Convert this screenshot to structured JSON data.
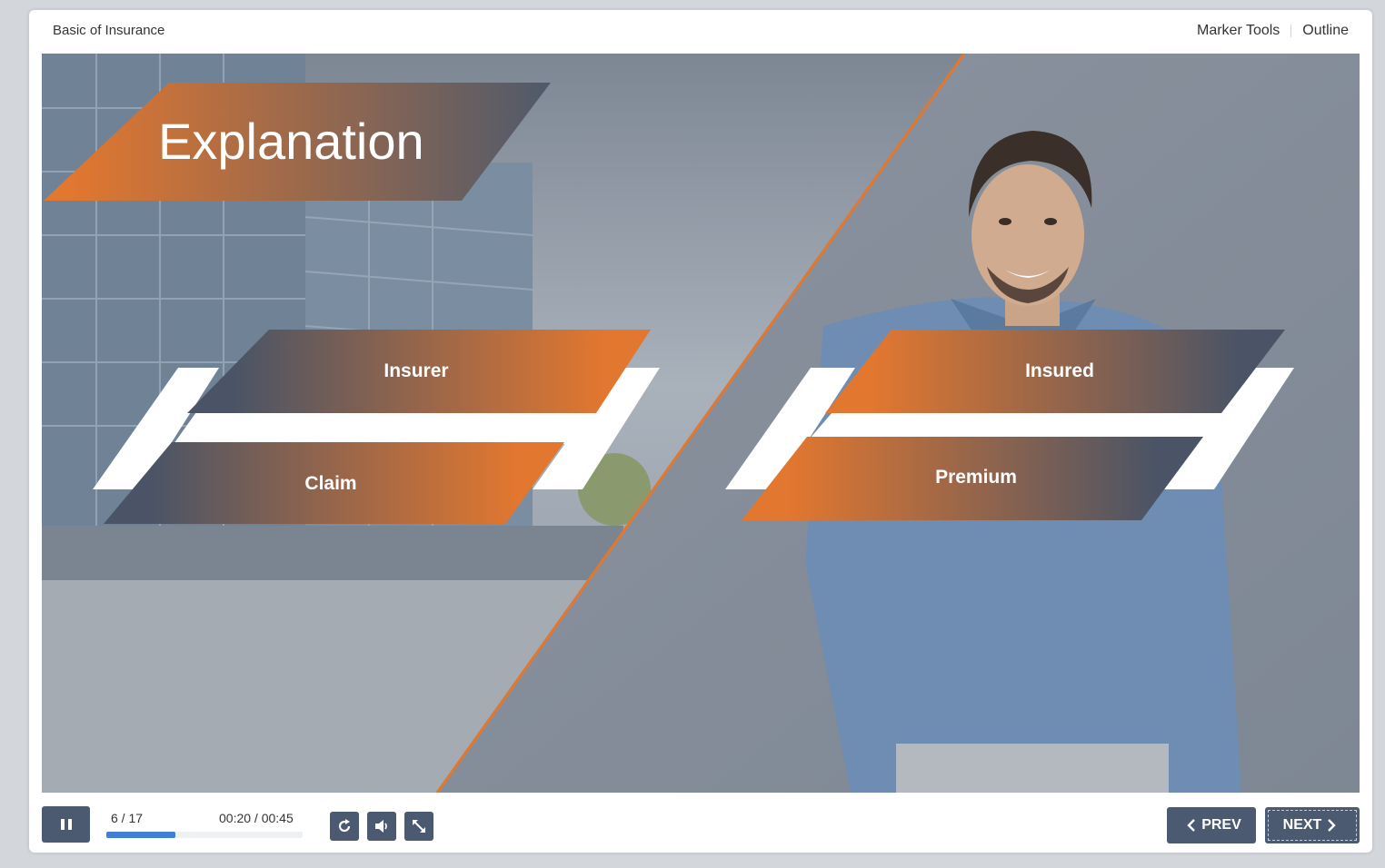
{
  "header": {
    "course_title": "Basic of Insurance",
    "links": [
      "Marker Tools",
      "Outline"
    ]
  },
  "slide": {
    "title": "Explanation",
    "left_pair": {
      "top": "Insurer",
      "bottom": "Claim"
    },
    "right_pair": {
      "top": "Insured",
      "bottom": "Premium"
    }
  },
  "player": {
    "slide_counter": "6 / 17",
    "time": "00:20 / 00:45",
    "progress": 0.35,
    "prev_label": "PREV",
    "next_label": "NEXT"
  },
  "icons": [
    "pause-icon",
    "replay-icon",
    "volume-icon",
    "fullscreen-icon",
    "chevron-left-icon",
    "chevron-right-icon"
  ],
  "colors": {
    "accent_orange": "#e2772f",
    "slate": "#4b5a70",
    "progress_blue": "#3f7fd8"
  }
}
